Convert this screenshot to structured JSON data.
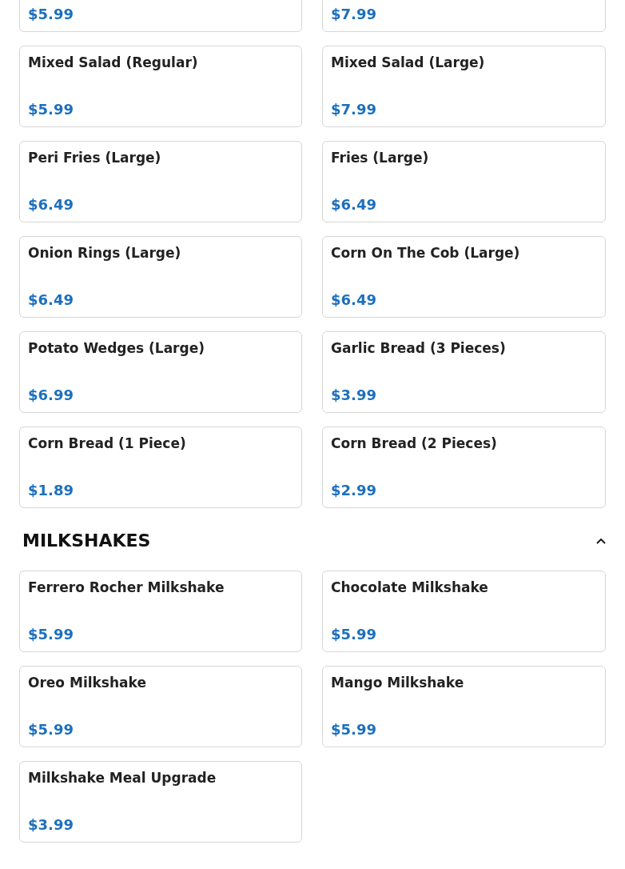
{
  "sections": [
    {
      "items": [
        {
          "price": "$5.99"
        },
        {
          "price": "$7.99"
        },
        {
          "name": "Mixed Salad (Regular)",
          "price": "$5.99"
        },
        {
          "name": "Mixed Salad (Large)",
          "price": "$7.99"
        },
        {
          "name": "Peri Fries (Large)",
          "price": "$6.49"
        },
        {
          "name": "Fries (Large)",
          "price": "$6.49"
        },
        {
          "name": "Onion Rings (Large)",
          "price": "$6.49"
        },
        {
          "name": "Corn On The Cob (Large)",
          "price": "$6.49"
        },
        {
          "name": "Potato Wedges (Large)",
          "price": "$6.99"
        },
        {
          "name": "Garlic Bread (3 Pieces)",
          "price": "$3.99"
        },
        {
          "name": "Corn Bread (1 Piece)",
          "price": "$1.89"
        },
        {
          "name": "Corn Bread (2 Pieces)",
          "price": "$2.99"
        }
      ]
    },
    {
      "heading": "MILKSHAKES",
      "expanded": true,
      "items": [
        {
          "name": "Ferrero Rocher Milkshake",
          "price": "$5.99"
        },
        {
          "name": "Chocolate Milkshake",
          "price": "$5.99"
        },
        {
          "name": "Oreo Milkshake",
          "price": "$5.99"
        },
        {
          "name": "Mango Milkshake",
          "price": "$5.99"
        },
        {
          "name": "Milkshake Meal Upgrade",
          "price": "$3.99"
        }
      ]
    }
  ]
}
